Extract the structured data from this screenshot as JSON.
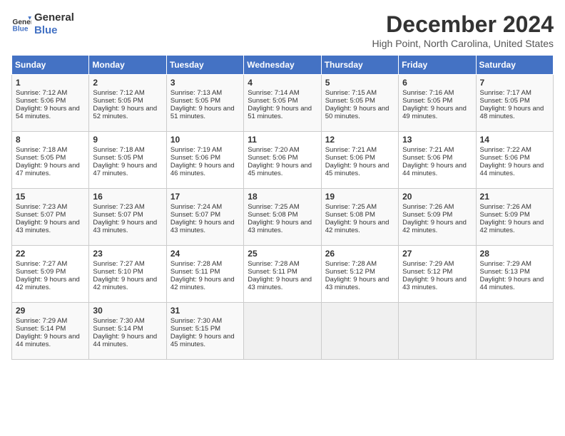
{
  "header": {
    "logo_line1": "General",
    "logo_line2": "Blue",
    "title": "December 2024",
    "subtitle": "High Point, North Carolina, United States"
  },
  "days_of_week": [
    "Sunday",
    "Monday",
    "Tuesday",
    "Wednesday",
    "Thursday",
    "Friday",
    "Saturday"
  ],
  "weeks": [
    [
      {
        "day": "1",
        "sunrise": "Sunrise: 7:12 AM",
        "sunset": "Sunset: 5:06 PM",
        "daylight": "Daylight: 9 hours and 54 minutes."
      },
      {
        "day": "2",
        "sunrise": "Sunrise: 7:12 AM",
        "sunset": "Sunset: 5:05 PM",
        "daylight": "Daylight: 9 hours and 52 minutes."
      },
      {
        "day": "3",
        "sunrise": "Sunrise: 7:13 AM",
        "sunset": "Sunset: 5:05 PM",
        "daylight": "Daylight: 9 hours and 51 minutes."
      },
      {
        "day": "4",
        "sunrise": "Sunrise: 7:14 AM",
        "sunset": "Sunset: 5:05 PM",
        "daylight": "Daylight: 9 hours and 51 minutes."
      },
      {
        "day": "5",
        "sunrise": "Sunrise: 7:15 AM",
        "sunset": "Sunset: 5:05 PM",
        "daylight": "Daylight: 9 hours and 50 minutes."
      },
      {
        "day": "6",
        "sunrise": "Sunrise: 7:16 AM",
        "sunset": "Sunset: 5:05 PM",
        "daylight": "Daylight: 9 hours and 49 minutes."
      },
      {
        "day": "7",
        "sunrise": "Sunrise: 7:17 AM",
        "sunset": "Sunset: 5:05 PM",
        "daylight": "Daylight: 9 hours and 48 minutes."
      }
    ],
    [
      {
        "day": "8",
        "sunrise": "Sunrise: 7:18 AM",
        "sunset": "Sunset: 5:05 PM",
        "daylight": "Daylight: 9 hours and 47 minutes."
      },
      {
        "day": "9",
        "sunrise": "Sunrise: 7:18 AM",
        "sunset": "Sunset: 5:05 PM",
        "daylight": "Daylight: 9 hours and 47 minutes."
      },
      {
        "day": "10",
        "sunrise": "Sunrise: 7:19 AM",
        "sunset": "Sunset: 5:06 PM",
        "daylight": "Daylight: 9 hours and 46 minutes."
      },
      {
        "day": "11",
        "sunrise": "Sunrise: 7:20 AM",
        "sunset": "Sunset: 5:06 PM",
        "daylight": "Daylight: 9 hours and 45 minutes."
      },
      {
        "day": "12",
        "sunrise": "Sunrise: 7:21 AM",
        "sunset": "Sunset: 5:06 PM",
        "daylight": "Daylight: 9 hours and 45 minutes."
      },
      {
        "day": "13",
        "sunrise": "Sunrise: 7:21 AM",
        "sunset": "Sunset: 5:06 PM",
        "daylight": "Daylight: 9 hours and 44 minutes."
      },
      {
        "day": "14",
        "sunrise": "Sunrise: 7:22 AM",
        "sunset": "Sunset: 5:06 PM",
        "daylight": "Daylight: 9 hours and 44 minutes."
      }
    ],
    [
      {
        "day": "15",
        "sunrise": "Sunrise: 7:23 AM",
        "sunset": "Sunset: 5:07 PM",
        "daylight": "Daylight: 9 hours and 43 minutes."
      },
      {
        "day": "16",
        "sunrise": "Sunrise: 7:23 AM",
        "sunset": "Sunset: 5:07 PM",
        "daylight": "Daylight: 9 hours and 43 minutes."
      },
      {
        "day": "17",
        "sunrise": "Sunrise: 7:24 AM",
        "sunset": "Sunset: 5:07 PM",
        "daylight": "Daylight: 9 hours and 43 minutes."
      },
      {
        "day": "18",
        "sunrise": "Sunrise: 7:25 AM",
        "sunset": "Sunset: 5:08 PM",
        "daylight": "Daylight: 9 hours and 43 minutes."
      },
      {
        "day": "19",
        "sunrise": "Sunrise: 7:25 AM",
        "sunset": "Sunset: 5:08 PM",
        "daylight": "Daylight: 9 hours and 42 minutes."
      },
      {
        "day": "20",
        "sunrise": "Sunrise: 7:26 AM",
        "sunset": "Sunset: 5:09 PM",
        "daylight": "Daylight: 9 hours and 42 minutes."
      },
      {
        "day": "21",
        "sunrise": "Sunrise: 7:26 AM",
        "sunset": "Sunset: 5:09 PM",
        "daylight": "Daylight: 9 hours and 42 minutes."
      }
    ],
    [
      {
        "day": "22",
        "sunrise": "Sunrise: 7:27 AM",
        "sunset": "Sunset: 5:09 PM",
        "daylight": "Daylight: 9 hours and 42 minutes."
      },
      {
        "day": "23",
        "sunrise": "Sunrise: 7:27 AM",
        "sunset": "Sunset: 5:10 PM",
        "daylight": "Daylight: 9 hours and 42 minutes."
      },
      {
        "day": "24",
        "sunrise": "Sunrise: 7:28 AM",
        "sunset": "Sunset: 5:11 PM",
        "daylight": "Daylight: 9 hours and 42 minutes."
      },
      {
        "day": "25",
        "sunrise": "Sunrise: 7:28 AM",
        "sunset": "Sunset: 5:11 PM",
        "daylight": "Daylight: 9 hours and 43 minutes."
      },
      {
        "day": "26",
        "sunrise": "Sunrise: 7:28 AM",
        "sunset": "Sunset: 5:12 PM",
        "daylight": "Daylight: 9 hours and 43 minutes."
      },
      {
        "day": "27",
        "sunrise": "Sunrise: 7:29 AM",
        "sunset": "Sunset: 5:12 PM",
        "daylight": "Daylight: 9 hours and 43 minutes."
      },
      {
        "day": "28",
        "sunrise": "Sunrise: 7:29 AM",
        "sunset": "Sunset: 5:13 PM",
        "daylight": "Daylight: 9 hours and 44 minutes."
      }
    ],
    [
      {
        "day": "29",
        "sunrise": "Sunrise: 7:29 AM",
        "sunset": "Sunset: 5:14 PM",
        "daylight": "Daylight: 9 hours and 44 minutes."
      },
      {
        "day": "30",
        "sunrise": "Sunrise: 7:30 AM",
        "sunset": "Sunset: 5:14 PM",
        "daylight": "Daylight: 9 hours and 44 minutes."
      },
      {
        "day": "31",
        "sunrise": "Sunrise: 7:30 AM",
        "sunset": "Sunset: 5:15 PM",
        "daylight": "Daylight: 9 hours and 45 minutes."
      },
      null,
      null,
      null,
      null
    ]
  ]
}
